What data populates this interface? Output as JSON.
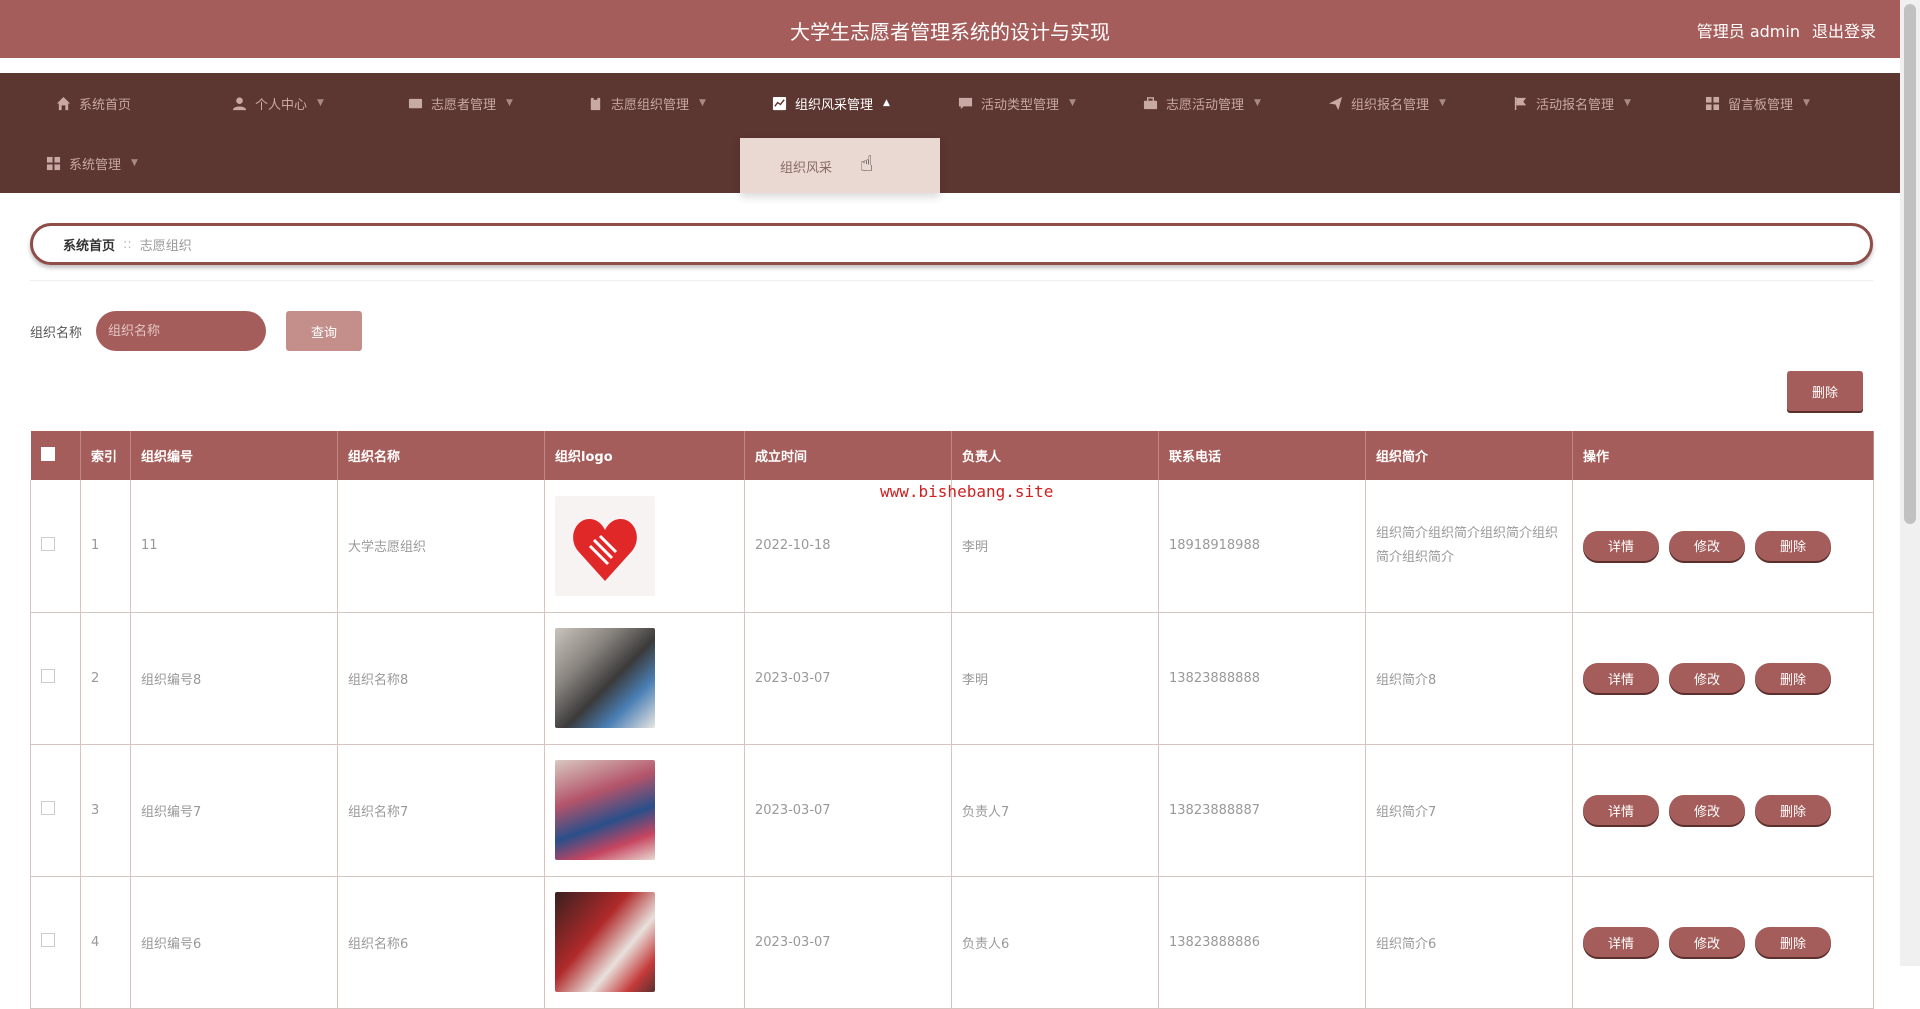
{
  "header": {
    "title": "大学生志愿者管理系统的设计与实现",
    "user_label": "管理员 admin",
    "logout_label": "退出登录"
  },
  "nav": {
    "items": [
      {
        "label": "系统首页",
        "icon": "home-icon"
      },
      {
        "label": "个人中心",
        "icon": "user-icon"
      },
      {
        "label": "志愿者管理",
        "icon": "id-card-icon"
      },
      {
        "label": "志愿组织管理",
        "icon": "clipboard-icon"
      },
      {
        "label": "组织风采管理",
        "icon": "chart-icon"
      },
      {
        "label": "活动类型管理",
        "icon": "chat-icon"
      },
      {
        "label": "志愿活动管理",
        "icon": "briefcase-icon"
      },
      {
        "label": "组织报名管理",
        "icon": "send-icon"
      },
      {
        "label": "活动报名管理",
        "icon": "flag-icon"
      },
      {
        "label": "留言板管理",
        "icon": "grid-icon"
      },
      {
        "label": "系统管理",
        "icon": "grid-icon"
      }
    ],
    "dropdown_item": "组织风采"
  },
  "breadcrumb": {
    "home": "系统首页",
    "current": "志愿组织"
  },
  "search": {
    "label": "组织名称",
    "placeholder": "组织名称",
    "button": "查询"
  },
  "toolbar": {
    "delete_label": "删除"
  },
  "table": {
    "headers": [
      "索引",
      "组织编号",
      "组织名称",
      "组织logo",
      "成立时间",
      "负责人",
      "联系电话",
      "组织简介",
      "操作"
    ],
    "rows": [
      {
        "index": "1",
        "code": "11",
        "name": "大学志愿组织",
        "logo": "heart-hands-logo",
        "date": "2022-10-18",
        "leader": "李明",
        "phone": "18918918988",
        "intro": "组织简介组织简介组织简介组织简介组织简介"
      },
      {
        "index": "2",
        "code": "组织编号8",
        "name": "组织名称8",
        "logo": "volunteer-photo",
        "date": "2023-03-07",
        "leader": "李明",
        "phone": "13823888888",
        "intro": "组织简介8"
      },
      {
        "index": "3",
        "code": "组织编号7",
        "name": "组织名称7",
        "logo": "volunteer-photo",
        "date": "2023-03-07",
        "leader": "负责人7",
        "phone": "13823888887",
        "intro": "组织简介7"
      },
      {
        "index": "4",
        "code": "组织编号6",
        "name": "组织名称6",
        "logo": "volunteer-photo",
        "date": "2023-03-07",
        "leader": "负责人6",
        "phone": "13823888886",
        "intro": "组织简介6"
      }
    ],
    "actions": {
      "detail": "详情",
      "edit": "修改",
      "delete": "删除"
    }
  },
  "watermark": "www.bishebang.site",
  "colors": {
    "header": "#a45d5a",
    "nav": "#5c3631",
    "accent": "#a45d5a"
  }
}
